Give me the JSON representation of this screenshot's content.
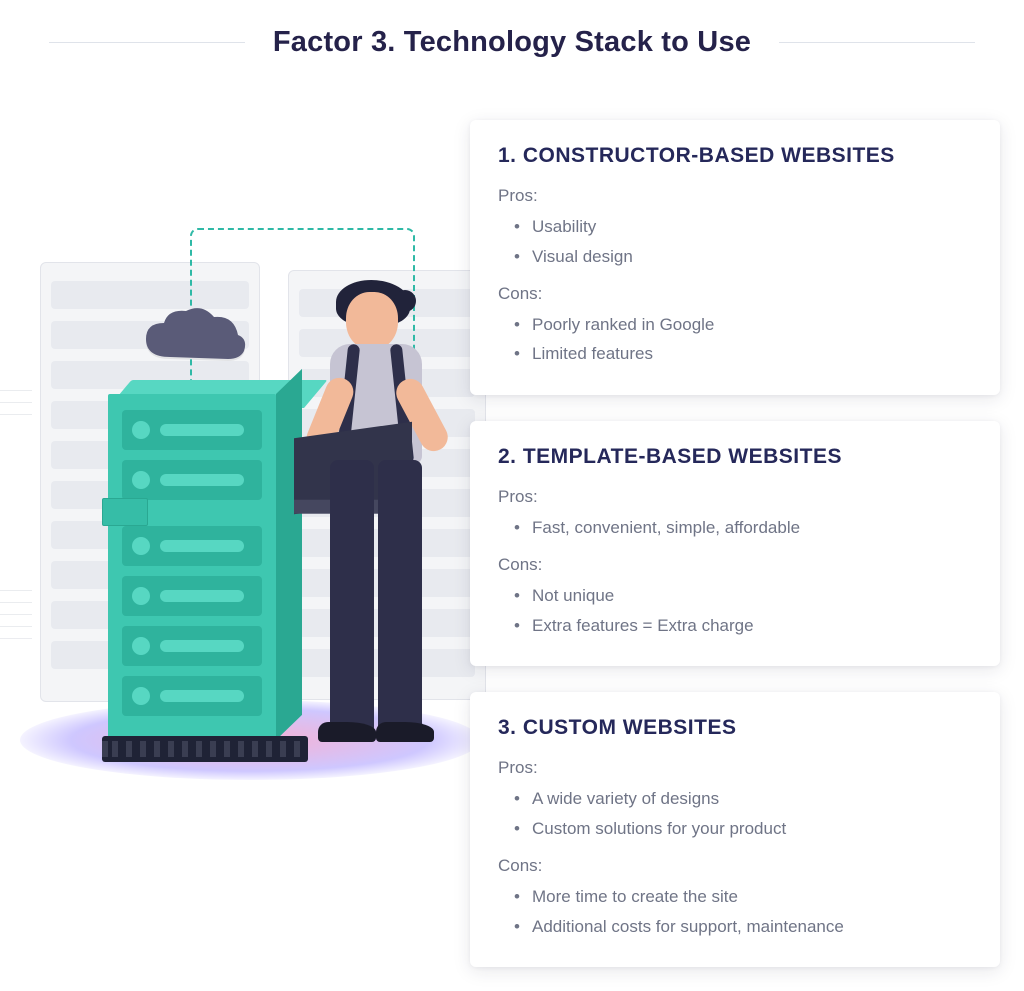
{
  "heading": "Factor 3. Technology Stack to Use",
  "labels": {
    "pros": "Pros:",
    "cons": "Cons:"
  },
  "cards": [
    {
      "title": "1. CONSTRUCTOR-BASED WEBSITES",
      "pros": [
        "Usability",
        "Visual design"
      ],
      "cons": [
        "Poorly ranked in Google",
        "Limited features"
      ]
    },
    {
      "title": "2. TEMPLATE-BASED WEBSITES",
      "pros": [
        "Fast, convenient, simple, affordable"
      ],
      "cons": [
        "Not unique",
        "Extra features = Extra charge"
      ]
    },
    {
      "title": "3. CUSTOM WEBSITES",
      "pros": [
        "A wide variety of designs",
        "Custom solutions for your product"
      ],
      "cons": [
        "More time to create the site",
        "Additional costs for support, maintenance"
      ]
    }
  ]
}
